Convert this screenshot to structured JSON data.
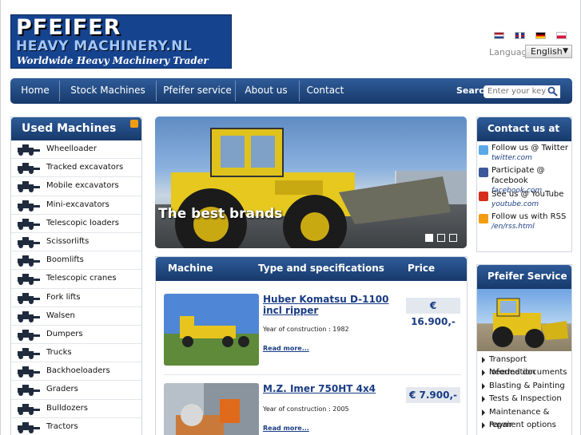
{
  "logo": {
    "line1": "PFEIFER",
    "line2": "HEAVY MACHINERY.NL",
    "line3": "Worldwide Heavy Machinery Trader"
  },
  "language": {
    "label": "Language",
    "selected": "English",
    "flags": [
      "dutch-flag-icon",
      "english-flag-icon",
      "german-flag-icon",
      "polish-flag-icon"
    ]
  },
  "nav": {
    "items": [
      "Home",
      "Stock Machines",
      "Pfeifer service",
      "About us",
      "Contact"
    ],
    "search_label": "Search",
    "search_placeholder": "Enter your keyw"
  },
  "sidebar": {
    "title": "Used Machines",
    "items": [
      {
        "label": "Wheelloader",
        "icon": "wheelloader-icon"
      },
      {
        "label": "Tracked excavators",
        "icon": "tracked-excavator-icon"
      },
      {
        "label": "Mobile excavators",
        "icon": "mobile-excavator-icon"
      },
      {
        "label": "Mini-excavators",
        "icon": "mini-excavator-icon"
      },
      {
        "label": "Telescopic loaders",
        "icon": "telescopic-loader-icon"
      },
      {
        "label": "Scissorlifts",
        "icon": "scissorlift-icon"
      },
      {
        "label": "Boomlifts",
        "icon": "boomlift-icon"
      },
      {
        "label": "Telescopic cranes",
        "icon": "telescopic-crane-icon"
      },
      {
        "label": "Fork lifts",
        "icon": "forklift-icon"
      },
      {
        "label": "Walsen",
        "icon": "roller-icon"
      },
      {
        "label": "Dumpers",
        "icon": "dumper-icon"
      },
      {
        "label": "Trucks",
        "icon": "truck-icon"
      },
      {
        "label": "Backhoeloaders",
        "icon": "backhoe-loader-icon"
      },
      {
        "label": "Graders",
        "icon": "grader-icon"
      },
      {
        "label": "Bulldozers",
        "icon": "bulldozer-icon"
      },
      {
        "label": "Tractors",
        "icon": "tractor-icon"
      }
    ]
  },
  "banner": {
    "caption": "The best brands",
    "active_slide": 1,
    "slide_count": 3
  },
  "listing": {
    "headers": [
      "Machine",
      "Type and specifications",
      "Price"
    ],
    "items": [
      {
        "title": "Huber Komatsu D-1100 incl ripper",
        "year": "Year of construction : 1982",
        "more": "Read more...",
        "price": "€ 16.900,-"
      },
      {
        "title": "M.Z. Imer 750HT 4x4",
        "year": "Year of construction : 2005",
        "more": "Read more...",
        "price": "€ 7.900,-"
      }
    ]
  },
  "contact": {
    "title": "Contact us at",
    "items": [
      {
        "text": "Follow us @ Twitter",
        "link": "twitter.com",
        "icon": "twitter-icon",
        "color": "#5aa9e6"
      },
      {
        "text": "Participate @ facebook",
        "link": "facebook.com",
        "icon": "facebook-icon",
        "color": "#3b5998"
      },
      {
        "text": "See us @ YouTube",
        "link": "youtube.com",
        "icon": "youtube-icon",
        "color": "#d62d20"
      },
      {
        "text": "Follow us with RSS",
        "link": "/en/rss.html",
        "icon": "rss-icon",
        "color": "#f39c12"
      }
    ]
  },
  "service": {
    "title": "Pfeifer Service",
    "items": [
      "Transport information",
      "Needed documents",
      "Blasting & Painting",
      "Tests & Inspection",
      "Maintenance & repair",
      "Payment options"
    ]
  },
  "colors": {
    "nav_dark": "#17396b",
    "nav_light": "#2f5c99",
    "link": "#1a3c84"
  }
}
